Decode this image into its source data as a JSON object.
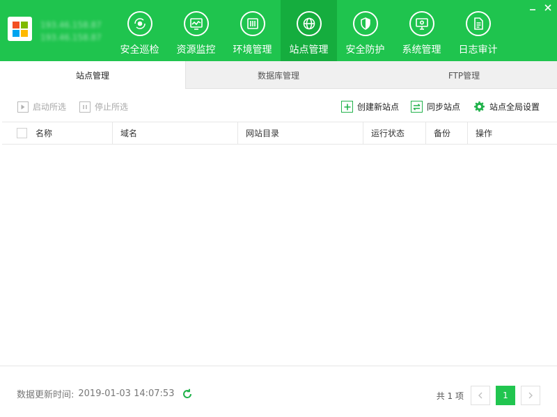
{
  "window": {
    "server_line1": "193.46.158.87",
    "server_line2": "193.46.158.87",
    "minimize_icon": "minimize-icon",
    "close_icon": "close-icon"
  },
  "nav": {
    "items": [
      {
        "label": "安全巡检",
        "icon": "scan-icon",
        "active": false
      },
      {
        "label": "资源监控",
        "icon": "monitor-chart-icon",
        "active": false
      },
      {
        "label": "环境管理",
        "icon": "server-icon",
        "active": false
      },
      {
        "label": "站点管理",
        "icon": "globe-icon",
        "active": true
      },
      {
        "label": "安全防护",
        "icon": "shield-icon",
        "active": false
      },
      {
        "label": "系统管理",
        "icon": "gear-monitor-icon",
        "active": false
      },
      {
        "label": "日志审计",
        "icon": "document-icon",
        "active": false
      }
    ]
  },
  "subtabs": [
    {
      "label": "站点管理",
      "active": true
    },
    {
      "label": "数据库管理",
      "active": false
    },
    {
      "label": "FTP管理",
      "active": false
    }
  ],
  "toolbar": {
    "start_selected": "启动所选",
    "stop_selected": "停止所选",
    "create_site": "创建新站点",
    "sync_sites": "同步站点",
    "global_settings": "站点全局设置"
  },
  "table": {
    "columns": [
      "名称",
      "域名",
      "网站目录",
      "运行状态",
      "备份",
      "操作"
    ],
    "rows": []
  },
  "footer": {
    "update_label": "数据更新时间:",
    "update_time": "2019-01-03 14:07:53",
    "total": "共 1 项",
    "current_page": "1"
  },
  "colors": {
    "brand": "#1fc44e",
    "brand_active": "#15ad3e",
    "accent": "#21c54f"
  }
}
